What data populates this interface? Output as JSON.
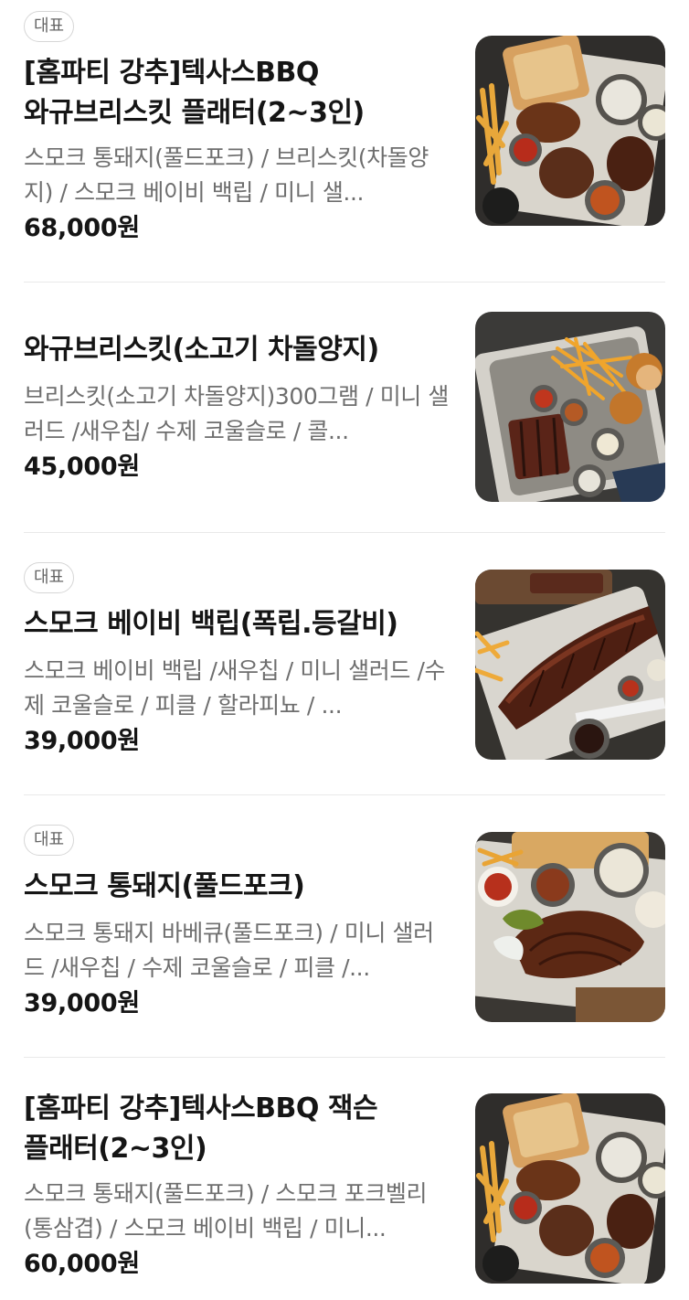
{
  "menu_items": [
    {
      "badge": "대표",
      "name": "[홈파티 강추]텍사스BBQ 와규브리스킷 플래터(2~3인)",
      "description": "스모크 통돼지(풀드포크) / 브리스킷(차돌양지) / 스모크 베이비 백립 / 미니 샐...",
      "price": "68,000원",
      "image_icon": "bbq-platter-photo"
    },
    {
      "badge": "",
      "name": "와규브리스킷(소고기 차돌양지)",
      "description": "브리스킷(소고기 차돌양지)300그램 / 미니 샐러드 /새우칩/ 수제 코울슬로 / 콜...",
      "price": "45,000원",
      "image_icon": "brisket-tray-photo"
    },
    {
      "badge": "대표",
      "name": "스모크 베이비 백립(폭립.등갈비)",
      "description": "스모크 베이비 백립 /새우칩 / 미니 샐러드 /수제 코울슬로 / 피클 / 할라피뇨 / ...",
      "price": "39,000원",
      "image_icon": "baby-back-ribs-photo"
    },
    {
      "badge": "대표",
      "name": "스모크 통돼지(풀드포크)",
      "description": "스모크 통돼지 바베큐(풀드포크) / 미니 샐러드 /새우칩 / 수제 코울슬로 / 피클 /...",
      "price": "39,000원",
      "image_icon": "pulled-pork-photo"
    },
    {
      "badge": "",
      "name": "[홈파티 강추]텍사스BBQ 잭슨 플래터(2~3인)",
      "description": "스모크 통돼지(풀드포크) / 스모크 포크벨리(통삼겹) / 스모크 베이비 백립 / 미니...",
      "price": "60,000원",
      "image_icon": "bbq-platter-photo"
    }
  ]
}
